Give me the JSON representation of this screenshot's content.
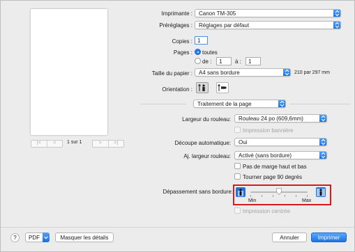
{
  "preview": {
    "page_counter": "1 sur 1",
    "nav_first": "|<",
    "nav_prev": "<",
    "nav_next": ">",
    "nav_last": ">|"
  },
  "printer": {
    "label": "Imprimante :",
    "value": "Canon TM-305"
  },
  "presets": {
    "label": "Préréglages :",
    "value": "Réglages par défaut"
  },
  "copies": {
    "label": "Copies :",
    "value": "1"
  },
  "pages": {
    "label": "Pages :",
    "all_label": "toutes",
    "from_label": "de :",
    "from_value": "1",
    "to_label": "à :",
    "to_value": "1"
  },
  "paper_size": {
    "label": "Taille du papier :",
    "value": "A4 sans bordure",
    "dimensions": "210 par 297 mm"
  },
  "orientation": {
    "label": "Orientation :"
  },
  "section": {
    "value": "Traitement de la page"
  },
  "roll_width": {
    "label": "Largeur du rouleau:",
    "value": "Rouleau 24 po (609,6mm)"
  },
  "banner": {
    "label": "Impression bannière"
  },
  "auto_cut": {
    "label": "Découpe automatique:",
    "value": "Oui"
  },
  "fit_roll": {
    "label": "Aj. largeur rouleau:",
    "value": "Activé (sans bordure)"
  },
  "no_margin": {
    "label": "Pas de marge haut et bas"
  },
  "rotate": {
    "label": "Tourner page 90 degrés"
  },
  "overflow": {
    "label": "Dépassement sans bordure:",
    "min_label": "Min",
    "max_label": "Max",
    "level": 0.5
  },
  "centered": {
    "label": "Impression centrée"
  },
  "footer": {
    "help": "?",
    "pdf": "PDF",
    "details": "Masquer les détails",
    "cancel": "Annuler",
    "print": "Imprimer"
  },
  "colors": {
    "accent": "#2b7bf0",
    "highlight_box": "#d71920"
  }
}
